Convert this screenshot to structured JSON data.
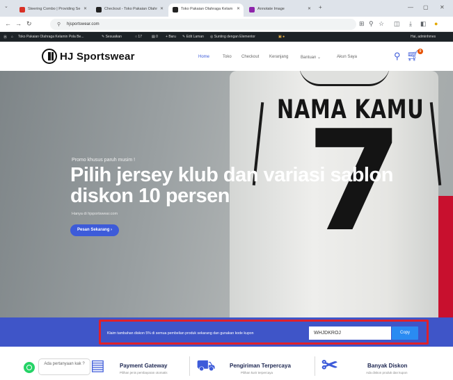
{
  "browser": {
    "tabs": [
      {
        "title": "Steering Combo | Providing Se"
      },
      {
        "title": "Checkout - Toko Pakaian Olahr"
      },
      {
        "title": "Toko Pakaian Olahraga Kelam"
      },
      {
        "title": "Annotate Image"
      }
    ],
    "url": "hjsportswear.com"
  },
  "adminbar": {
    "site": "Toko Pakaian Olahraga Kelamin Pola Be...",
    "customize": "Sesuaikan",
    "comments": "17",
    "updates": "0",
    "new": "Baru",
    "edit": "Edit Laman",
    "builder": "Sunting dengan Elementor",
    "greeting": "Hai, adminhmes"
  },
  "header": {
    "brand": "HJ Sportswear",
    "menu": [
      "Home",
      "Toko",
      "Checkout",
      "Keranjang",
      "Bantuan ⌄",
      "Akun Saya"
    ],
    "cart_count": "0"
  },
  "hero": {
    "jersey_name": "NAMA KAMU",
    "jersey_number": "7",
    "kicker": "Promo khusus paruh musim !",
    "title_line1": "Pilih jersey klub dan variasi sablon",
    "title_line2": "diskon 10 persen",
    "subtitle": "Hanya di hjsportswear.com",
    "cta": "Pesan Sekarang ›"
  },
  "coupon": {
    "text": "Klaim tambahan diskon 5% di semua pembelian produk sekarang dan gunakan kode kupon",
    "code": "WHJDKROJ",
    "copy": "Copy"
  },
  "features": {
    "whatsapp_bubble": "Ada pertanyaan kak ?",
    "items": [
      {
        "title": "Payment Gateway",
        "subtitle": "Pilihan jenis pembayaran otomatis"
      },
      {
        "title": "Pengiriman Terpercaya",
        "subtitle": "Pilihan kurir terpercaya"
      },
      {
        "title": "Banyak Diskon",
        "subtitle": "Ada diskon produk dan kupon"
      }
    ]
  },
  "colors": {
    "accent": "#3d5bd9",
    "coupon_band": "#3f55c8",
    "annotation_box": "#e0202a",
    "copy_button": "#2a8bf2",
    "whatsapp": "#25d366"
  }
}
